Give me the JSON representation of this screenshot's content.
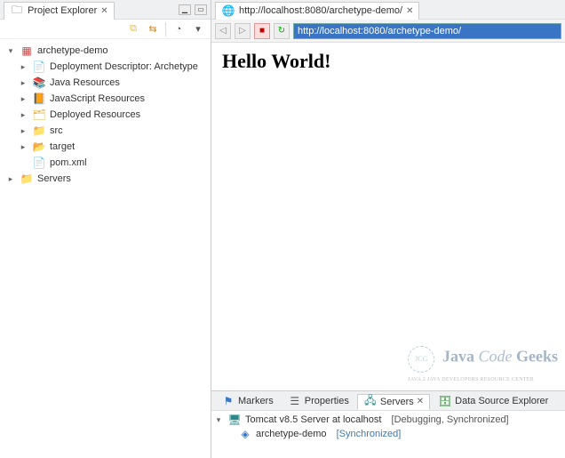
{
  "explorer": {
    "tab_title": "Project Explorer",
    "toolbar": {
      "collapse_all": "⤡",
      "link": "⇄",
      "filter": "▿",
      "menu": "▾"
    },
    "tree": {
      "project": {
        "name": "archetype-demo",
        "children": {
          "dd": {
            "label": "Deployment Descriptor: Archetype"
          },
          "java": {
            "label": "Java Resources"
          },
          "js": {
            "label": "JavaScript Resources"
          },
          "deploy": {
            "label": "Deployed Resources"
          },
          "src": {
            "label": "src"
          },
          "target": {
            "label": "target"
          },
          "pom": {
            "label": "pom.xml"
          }
        }
      },
      "servers": {
        "label": "Servers"
      }
    }
  },
  "browser": {
    "tab_title": "http://localhost:8080/archetype-demo/",
    "url": "http://localhost:8080/archetype-demo/",
    "page_heading": "Hello World!",
    "watermark": {
      "main_a": "Java",
      "main_b": "Code",
      "main_c": "Geeks",
      "sub": "JAVA 2 JAVA DEVELOPERS RESOURCE CENTER",
      "logo_text": "JCG"
    }
  },
  "bottom": {
    "tabs": {
      "markers": "Markers",
      "properties": "Properties",
      "servers": "Servers",
      "dse": "Data Source Explorer"
    },
    "server": {
      "name": "Tomcat v8.5 Server at localhost",
      "status": "[Debugging, Synchronized]",
      "module": {
        "name": "archetype-demo",
        "status": "[Synchronized]"
      }
    }
  }
}
